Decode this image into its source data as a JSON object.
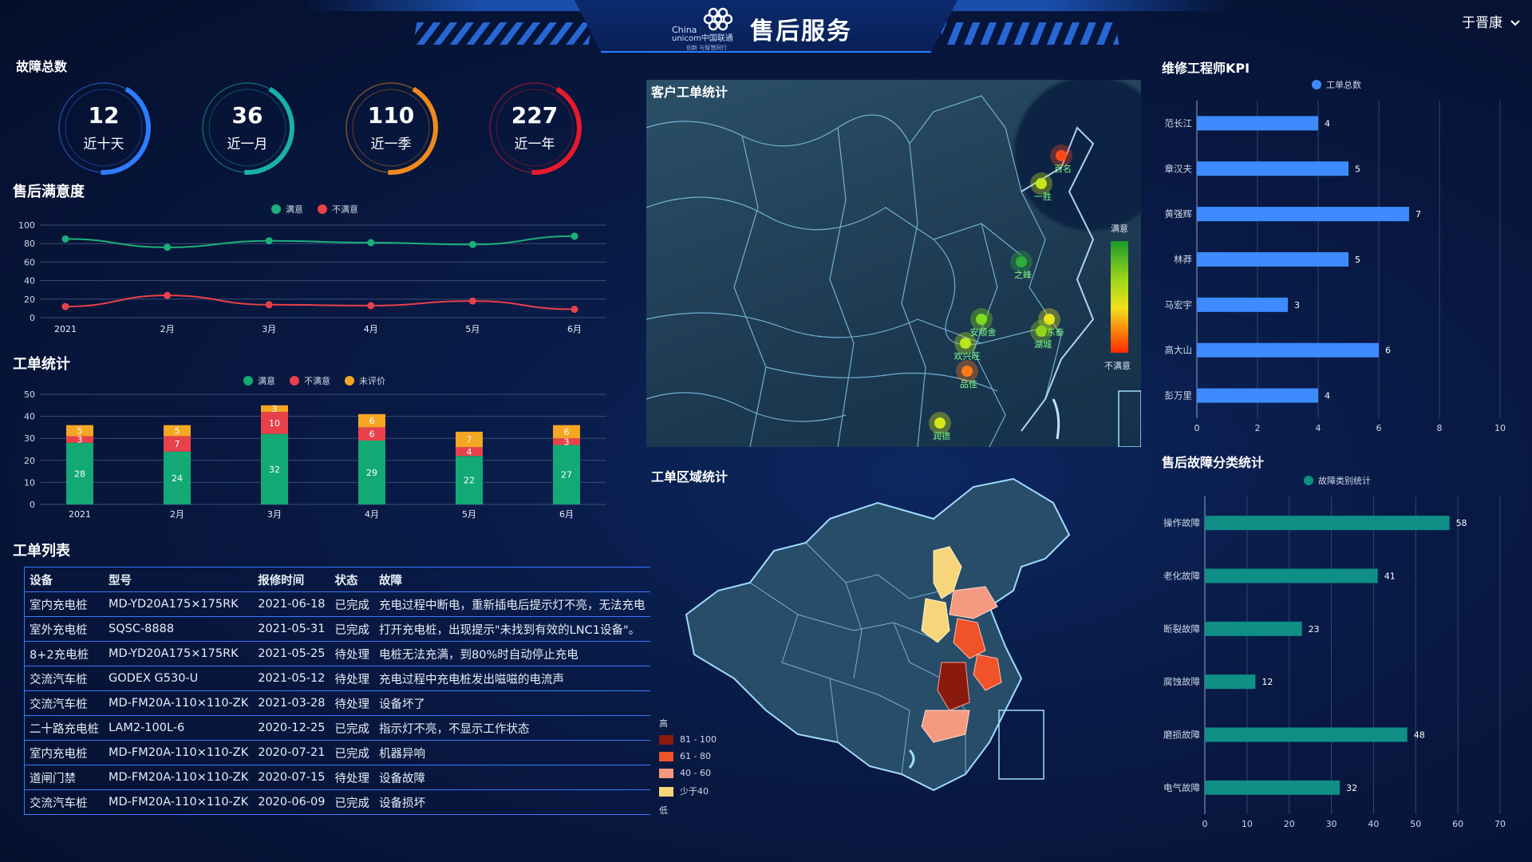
{
  "header": {
    "title": "售后服务",
    "logo_line1": "China",
    "logo_line2": "unicom中国联通",
    "logo_line3": "创新 与智慧同行",
    "user": "于晋康"
  },
  "fault_total": {
    "title": "故障总数",
    "rings": [
      {
        "value": "12",
        "label": "近十天",
        "color": "#2f7bff"
      },
      {
        "value": "36",
        "label": "近一月",
        "color": "#19b0a7"
      },
      {
        "value": "110",
        "label": "近一季",
        "color": "#f08a1c"
      },
      {
        "value": "227",
        "label": "近一年",
        "color": "#e8192c"
      }
    ]
  },
  "satisfaction": {
    "title": "售后满意度",
    "legend": [
      "满意",
      "不满意"
    ],
    "colors": {
      "satisfied": "#1bb07a",
      "unsatisfied": "#e8414a"
    }
  },
  "ticket_stats": {
    "title": "工单统计",
    "legend": [
      "满意",
      "不满意",
      "未评价"
    ],
    "colors": {
      "satisfied": "#12a975",
      "unsatisfied": "#e8414a",
      "unrated": "#f5a623"
    }
  },
  "ticket_list": {
    "title": "工单列表",
    "headers": [
      "设备",
      "型号",
      "报修时间",
      "状态",
      "故障"
    ],
    "rows": [
      [
        "室内充电桩",
        "MD-YD20A175×175RK",
        "2021-06-18",
        "已完成",
        "充电过程中断电，重新插电后提示灯不亮，无法充电"
      ],
      [
        "室外充电桩",
        "SQSC-8888",
        "2021-05-31",
        "已完成",
        "打开充电桩，出现提示\"未找到有效的LNC1设备\"。"
      ],
      [
        "8+2充电桩",
        "MD-YD20A175×175RK",
        "2021-05-25",
        "待处理",
        "电桩无法充满，到80%时自动停止充电"
      ],
      [
        "交流汽车桩",
        "GODEX G530-U",
        "2021-05-12",
        "待处理",
        "充电过程中充电桩发出嗞嗞的电流声"
      ],
      [
        "交流汽车桩",
        "MD-FM20A-110×110-ZK",
        "2021-03-28",
        "待处理",
        "设备坏了"
      ],
      [
        "二十路充电桩",
        "LAM2-100L-6",
        "2020-12-25",
        "已完成",
        "指示灯不亮，不显示工作状态"
      ],
      [
        "室内充电桩",
        "MD-FM20A-110×110-ZK",
        "2020-07-21",
        "已完成",
        "机器异响"
      ],
      [
        "道闸门禁",
        "MD-FM20A-110×110-ZK",
        "2020-07-15",
        "待处理",
        "设备故障"
      ],
      [
        "交流汽车桩",
        "MD-FM20A-110×110-ZK",
        "2020-06-09",
        "已完成",
        "设备损坏"
      ]
    ]
  },
  "customer_map": {
    "title": "客户工单统计",
    "scale_high": "满意",
    "scale_low": "不满意",
    "markers": [
      {
        "label": "百名",
        "color": "#ff4a1a"
      },
      {
        "label": "一胜",
        "color": "#c6e61a"
      },
      {
        "label": "之峰",
        "color": "#2fae3a"
      },
      {
        "label": "安顺舍",
        "color": "#7fdc1a"
      },
      {
        "label": "吕东泰",
        "color": "#e6e61a"
      },
      {
        "label": "湖城",
        "color": "#8fd61a"
      },
      {
        "label": "欢兴旺",
        "color": "#b8e61a"
      },
      {
        "label": "品佳",
        "color": "#ff7a1a"
      },
      {
        "label": "润德",
        "color": "#d6e61a"
      }
    ]
  },
  "region_map": {
    "title": "工单区域统计",
    "legend_high": "高",
    "legend_low": "低",
    "ranges": [
      {
        "label": "81 - 100",
        "color": "#8b1a0e"
      },
      {
        "label": "61 - 80",
        "color": "#f0522a"
      },
      {
        "label": "40 - 60",
        "color": "#f59a80"
      },
      {
        "label": "少于40",
        "color": "#f7d57a"
      }
    ]
  },
  "engineer_kpi": {
    "title": "维修工程师KPI",
    "legend": "工单总数",
    "color": "#3d8bff"
  },
  "fault_category": {
    "title": "售后故障分类统计",
    "legend": "故障类别统计",
    "color": "#0f8f86"
  },
  "chart_data": [
    {
      "type": "line",
      "x": [
        "2021",
        "2月",
        "3月",
        "4月",
        "5月",
        "6月"
      ],
      "series": [
        {
          "name": "满意",
          "values": [
            85,
            76,
            83,
            81,
            79,
            88
          ]
        },
        {
          "name": "不满意",
          "values": [
            12,
            24,
            14,
            13,
            18,
            9
          ]
        }
      ],
      "ylim": [
        0,
        100
      ],
      "yticks": [
        0,
        20,
        40,
        60,
        80,
        100
      ]
    },
    {
      "type": "bar",
      "stacked": true,
      "categories": [
        "2021",
        "2月",
        "3月",
        "4月",
        "5月",
        "6月"
      ],
      "series": [
        {
          "name": "满意",
          "values": [
            28,
            24,
            32,
            29,
            22,
            27
          ]
        },
        {
          "name": "不满意",
          "values": [
            3,
            7,
            10,
            6,
            4,
            3
          ]
        },
        {
          "name": "未评价",
          "values": [
            5,
            5,
            3,
            6,
            7,
            6
          ]
        }
      ],
      "ylim": [
        0,
        50
      ],
      "yticks": [
        0,
        10,
        20,
        30,
        40,
        50
      ]
    },
    {
      "type": "bar",
      "orientation": "horizontal",
      "categories": [
        "范长江",
        "章汉夫",
        "黄强辉",
        "林莽",
        "马宏宇",
        "高大山",
        "彭万里"
      ],
      "series": [
        {
          "name": "工单总数",
          "values": [
            4,
            5,
            7,
            5,
            3,
            6,
            4
          ]
        }
      ],
      "xlim": [
        0,
        10
      ],
      "xticks": [
        0,
        2,
        4,
        6,
        8,
        10
      ]
    },
    {
      "type": "bar",
      "orientation": "horizontal",
      "categories": [
        "操作故障",
        "老化故障",
        "断裂故障",
        "腐蚀故障",
        "磨损故障",
        "电气故障"
      ],
      "series": [
        {
          "name": "故障类别统计",
          "values": [
            58,
            41,
            23,
            12,
            48,
            32
          ]
        }
      ],
      "xlim": [
        0,
        70
      ],
      "xticks": [
        0,
        10,
        20,
        30,
        40,
        50,
        60,
        70
      ]
    }
  ]
}
